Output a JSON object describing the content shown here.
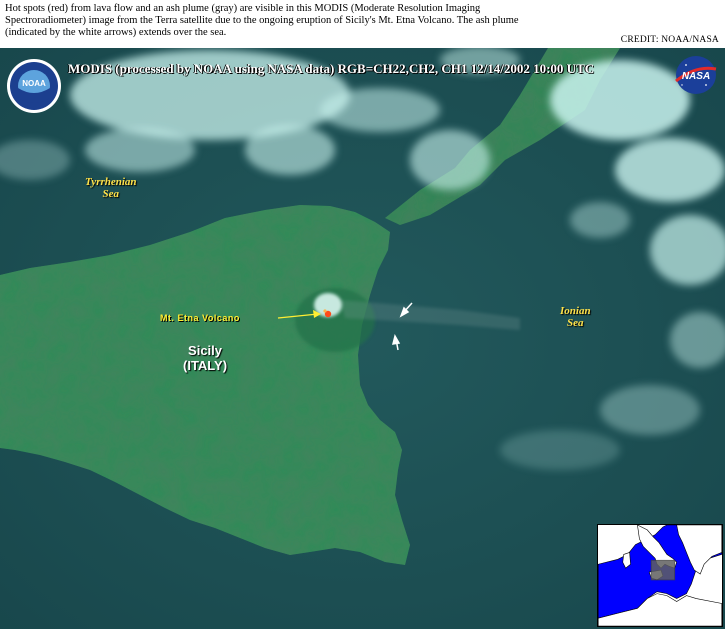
{
  "caption": "Hot spots (red) from lava flow and an ash plume (gray) are visible in this MODIS (Moderate Resolution Imaging Spectroradiometer) image from the Terra satellite due to the ongoing eruption of Sicily's Mt. Etna Volcano.  The ash plume (indicated by the white arrows) extends over the sea.",
  "credit": "CREDIT: NOAA/NASA",
  "banner": "MODIS  (processed by NOAA using NASA data)  RGB=CH22,CH2, CH1  12/14/2002  10:00 UTC",
  "labels": {
    "tyrrhenian_line1": "Tyrrhenian",
    "tyrrhenian_line2": "Sea",
    "ionian_line1": "Ionian",
    "ionian_line2": "Sea",
    "volcano": "Mt. Etna Volcano",
    "sicily_line1": "Sicily",
    "sicily_line2": "(ITALY)"
  },
  "logos": {
    "noaa": "NOAA",
    "nasa": "NASA"
  },
  "colors": {
    "sea": "#1d4f52",
    "land": "#2e8a58",
    "cloud": "#c9f3ee",
    "label_yellow": "#ffe24a",
    "hotspot": "#ff4a1a"
  }
}
